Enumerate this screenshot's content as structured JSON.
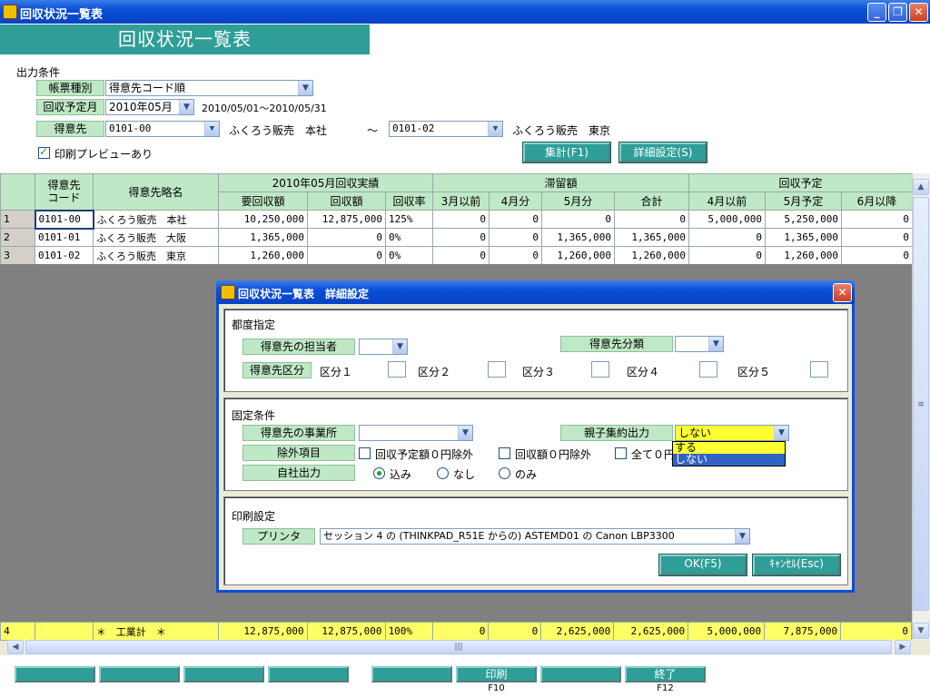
{
  "window": {
    "title": "回収状況一覧表",
    "min": "_",
    "max": "❐",
    "close": "✕"
  },
  "header": {
    "title": "回収状況一覧表"
  },
  "form": {
    "section_label": "出力条件",
    "report_type_label": "帳票種別",
    "report_type_value": "得意先コード順",
    "month_label": "回収予定月",
    "month_value": "2010年05月",
    "date_range": "2010/05/01～2010/05/31",
    "customer_label": "得意先",
    "customer_from": "0101-00",
    "customer_from_name": "ふくろう販売　本社",
    "tilde": "～",
    "customer_to": "0101-02",
    "customer_to_name": "ふくろう販売　東京",
    "preview_label": "印刷プレビューあり",
    "sum_button": "集計(F1)",
    "detail_button": "詳細設定(S)"
  },
  "grid": {
    "headers": {
      "code": "得意先\nコード",
      "name": "得意先略名",
      "group_actual": "2010年05月回収実績",
      "group_overdue": "滞留額",
      "group_plan": "回収予定",
      "cols": [
        "要回収額",
        "回収額",
        "回収率",
        "3月以前",
        "4月分",
        "5月分",
        "合計",
        "4月以前",
        "5月予定",
        "6月以降"
      ]
    },
    "rows": [
      {
        "no": "1",
        "code": "0101-00",
        "name": "ふくろう販売　本社",
        "cells": [
          "10,250,000",
          "12,875,000",
          "125%",
          "0",
          "0",
          "0",
          "0",
          "5,000,000",
          "5,250,000",
          "0"
        ]
      },
      {
        "no": "2",
        "code": "0101-01",
        "name": "ふくろう販売　大阪",
        "cells": [
          "1,365,000",
          "0",
          "0%",
          "0",
          "0",
          "1,365,000",
          "1,365,000",
          "0",
          "1,365,000",
          "0"
        ]
      },
      {
        "no": "3",
        "code": "0101-02",
        "name": "ふくろう販売　東京",
        "cells": [
          "1,260,000",
          "0",
          "0%",
          "0",
          "0",
          "1,260,000",
          "1,260,000",
          "0",
          "1,260,000",
          "0"
        ]
      }
    ],
    "total": {
      "no": "4",
      "code": "",
      "name": "＊　工業計　＊",
      "cells": [
        "12,875,000",
        "12,875,000",
        "100%",
        "0",
        "0",
        "2,625,000",
        "2,625,000",
        "5,000,000",
        "7,875,000",
        "0"
      ]
    }
  },
  "dialog": {
    "title": "回収状況一覧表　詳細設定",
    "sec1": {
      "title": "都度指定",
      "staff_label": "得意先の担当者",
      "class_label": "得意先分類",
      "kubun_label": "得意先区分",
      "kubun": [
        "区分１",
        "区分２",
        "区分３",
        "区分４",
        "区分５"
      ]
    },
    "sec2": {
      "title": "固定条件",
      "office_label": "得意先の事業所",
      "oyako_label": "親子集約出力",
      "oyako_value": "しない",
      "oyako_options": [
        "する",
        "しない"
      ],
      "exclude_label": "除外項目",
      "exclude": [
        "回収予定額０円除外",
        "回収額０円除外",
        "全て０円"
      ],
      "own_label": "自社出力",
      "own_opts": [
        "込み",
        "なし",
        "のみ"
      ]
    },
    "sec3": {
      "title": "印刷設定",
      "printer_label": "プリンタ",
      "printer_value": "セッション 4 の (THINKPAD_R51E からの) ASTEMD01 の Canon LBP3300"
    },
    "ok": "OK(F5)",
    "cancel": "ｷｬﾝｾﾙ(Esc)"
  },
  "fkeys": {
    "print": "印刷",
    "print_key": "F10",
    "end": "終了",
    "end_key": "F12"
  }
}
